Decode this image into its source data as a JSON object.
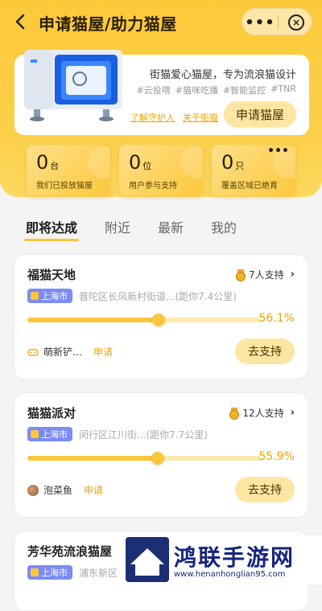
{
  "header": {
    "title": "申请猫屋/助力猫屋",
    "more_label": "•••",
    "close_label": "×"
  },
  "hero": {
    "tagline": "街猫爱心猫屋，专为流浪猫设计",
    "tags": [
      "#云投喂",
      "#猫咪吃播",
      "#智能监控",
      "#TNR"
    ],
    "link_guardian": "了解守护人",
    "link_about": "关于街猫",
    "apply_button": "申请猫屋"
  },
  "stats": [
    {
      "value": "0",
      "unit": "台",
      "label": "我们已投放猫屋"
    },
    {
      "value": "0",
      "unit": "位",
      "label": "用户参与支持"
    },
    {
      "value": "0",
      "unit": "只",
      "label": "覆盖区域已绝育",
      "more": "•••"
    }
  ],
  "tabs": [
    "即将达成",
    "附近",
    "最新",
    "我的"
  ],
  "active_tab": 0,
  "cards": [
    {
      "name": "福猫天地",
      "support": "7人支持",
      "city": "上海市",
      "address": "普陀区长风新村街道...(距你7.4公里)",
      "progress_pct": 56.1,
      "progress_label": "56.1%",
      "applicant": "萌新铲…",
      "applicant_state": "申请",
      "button": "去支持"
    },
    {
      "name": "猫猫派对",
      "support": "12人支持",
      "city": "上海市",
      "address": "闵行区江川街...(距你7.7公里)",
      "progress_pct": 55.9,
      "progress_label": "55.9%",
      "applicant": "泡菜鱼",
      "applicant_state": "申请",
      "button": "去支持"
    },
    {
      "name": "芳华苑流浪猫屋",
      "city": "上海市",
      "address": "浦东新区"
    }
  ],
  "watermark": {
    "title": "鸿联手游网",
    "url": "www.henanhonglian95.com"
  },
  "colors": {
    "brand_yellow": "#fcc63a",
    "accent_orange": "#f0a500",
    "city_badge": "#7b8cf5"
  }
}
